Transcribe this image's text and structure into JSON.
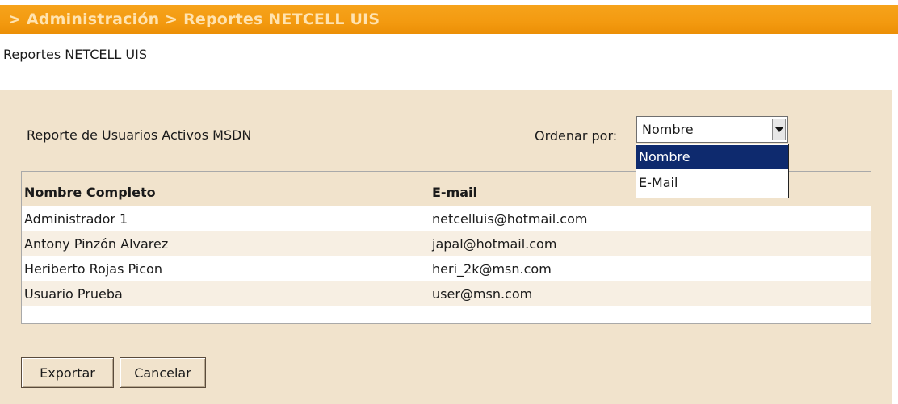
{
  "breadcrumb": "> Administración > Reportes NETCELL UIS",
  "page_title": "Reportes NETCELL UIS",
  "report": {
    "title": "Reporte de Usuarios Activos MSDN",
    "sort_label": "Ordenar por:",
    "sort_selected": "Nombre",
    "sort_options": [
      "Nombre",
      "E-Mail"
    ]
  },
  "table": {
    "columns": [
      "Nombre Completo",
      "E-mail"
    ],
    "rows": [
      [
        "Administrador 1",
        "netcelluis@hotmail.com"
      ],
      [
        "Antony Pinzón Alvarez",
        "japal@hotmail.com"
      ],
      [
        "Heriberto Rojas Picon",
        "heri_2k@msn.com"
      ],
      [
        "Usuario Prueba",
        "user@msn.com"
      ]
    ]
  },
  "actions": {
    "export_label": "Exportar",
    "cancel_label": "Cancelar"
  },
  "colors": {
    "banner": "#f39a10",
    "panel": "#f1e3cc",
    "selected_option": "#0e2a6e"
  },
  "icons": {
    "select_arrow": "chevron-down-icon"
  }
}
